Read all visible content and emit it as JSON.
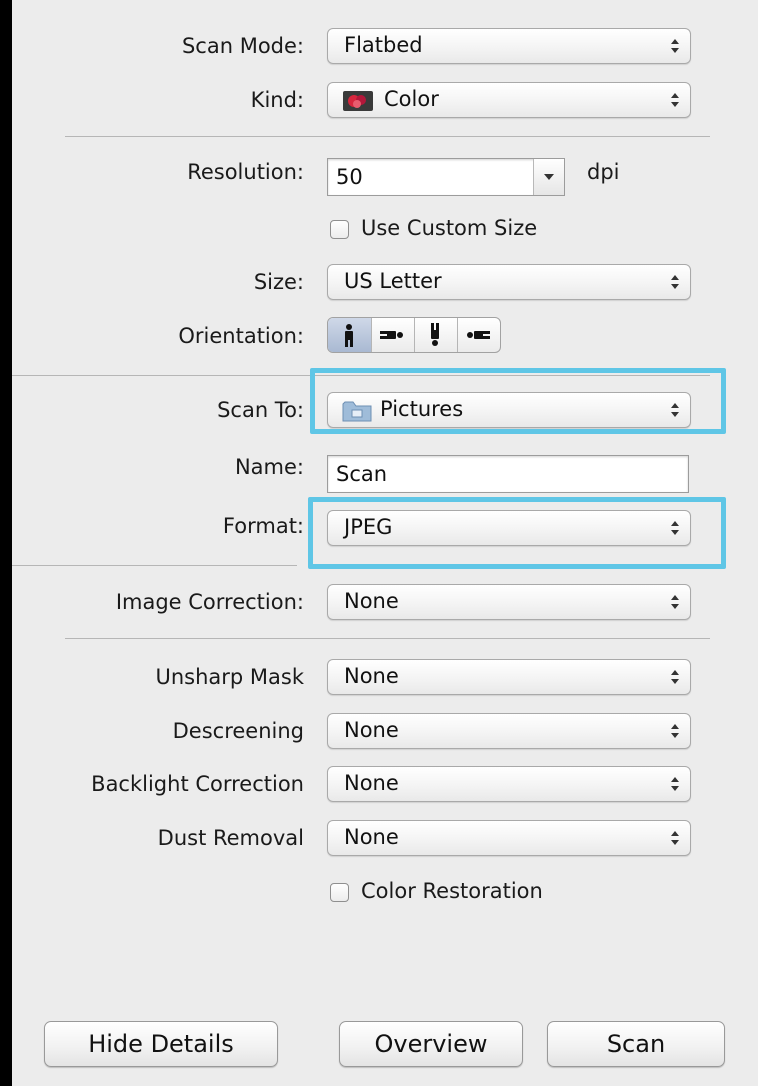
{
  "scan_mode": {
    "label": "Scan Mode:",
    "value": "Flatbed"
  },
  "kind": {
    "label": "Kind:",
    "value": "Color",
    "icon": "color-swatch-icon"
  },
  "resolution": {
    "label": "Resolution:",
    "value": "50",
    "unit": "dpi"
  },
  "custom_size": {
    "label": "Use Custom Size",
    "checked": false
  },
  "size": {
    "label": "Size:",
    "value": "US Letter"
  },
  "orientation": {
    "label": "Orientation:",
    "options": [
      "portrait-upright-icon",
      "landscape-left-icon",
      "portrait-upside-down-icon",
      "landscape-right-icon"
    ],
    "selected_index": 0
  },
  "scan_to": {
    "label": "Scan To:",
    "value": "Pictures",
    "icon": "folder-icon"
  },
  "name": {
    "label": "Name:",
    "value": "Scan"
  },
  "format": {
    "label": "Format:",
    "value": "JPEG"
  },
  "image_correction": {
    "label": "Image Correction:",
    "value": "None"
  },
  "unsharp_mask": {
    "label": "Unsharp Mask",
    "value": "None"
  },
  "descreening": {
    "label": "Descreening",
    "value": "None"
  },
  "backlight_correction": {
    "label": "Backlight Correction",
    "value": "None"
  },
  "dust_removal": {
    "label": "Dust Removal",
    "value": "None"
  },
  "color_restoration": {
    "label": "Color Restoration",
    "checked": false
  },
  "buttons": {
    "hide_details": "Hide Details",
    "overview": "Overview",
    "scan": "Scan"
  },
  "colors": {
    "highlight": "#5fc6e6",
    "panel_bg": "#ececec",
    "window_bg": "#000000"
  }
}
